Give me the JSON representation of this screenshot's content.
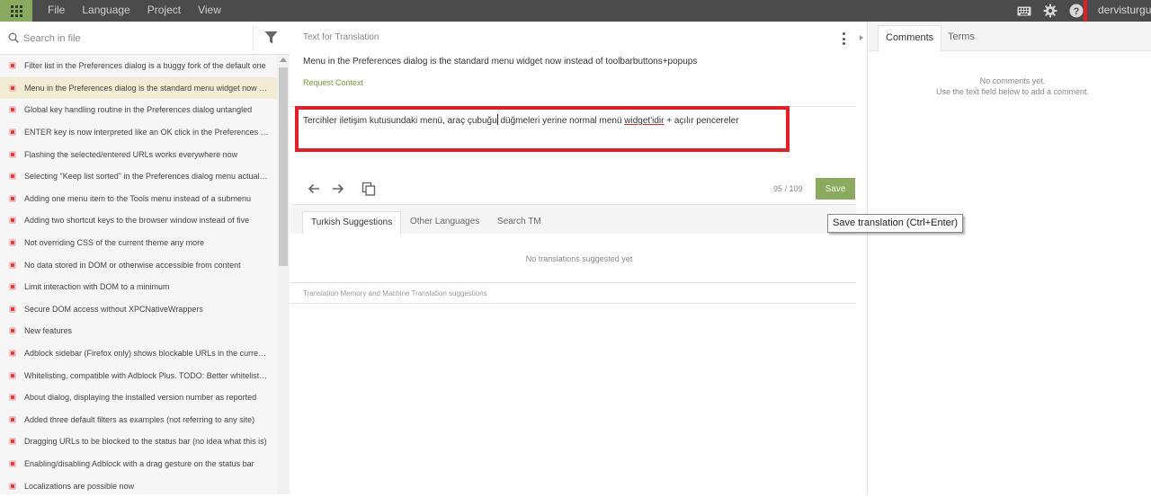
{
  "topbar": {
    "menu": [
      "File",
      "Language",
      "Project",
      "View"
    ],
    "icons": [
      "keyboard-icon",
      "gear-icon",
      "help-icon"
    ],
    "username": "dervisturgut",
    "colors": {
      "bar": "#4b4b4b",
      "accent": "#8aab5f",
      "highlight_box": "#e01f26"
    }
  },
  "sidebar": {
    "search_placeholder": "Search in file",
    "items": [
      "Filter list in the Preferences dialog is a buggy fork of the default one",
      "Menu in the Preferences dialog is the standard menu widget now instead",
      "Global key handling routine in the Preferences dialog untangled",
      "ENTER key is now interpreted like an OK click in the Preferences dialog",
      "Flashing the selected/entered URLs works everywhere now",
      "Selecting \"Keep list sorted\" in the Preferences dialog menu actually sorts",
      "Adding one menu item to the Tools menu instead of a submenu",
      "Adding two shortcut keys to the browser window instead of five",
      "Not overriding CSS of the current theme any more",
      "No data stored in DOM or otherwise accessible from content",
      "Limit interaction with DOM to a minimum",
      "Secure DOM access without XPCNativeWrappers",
      "New features",
      "Adblock sidebar (Firefox only) shows blockable URLs in the current page",
      "Whitelisting, compatible with Adblock Plus. TODO: Better whitelisting",
      "About dialog, displaying the installed version number as reported",
      "Added three default filters as examples (not referring to any site)",
      "Dragging URLs to be blocked to the status bar (no idea what this is)",
      "Enabling/disabling Adblock with a drag gesture on the status bar",
      "Localizations are possible now"
    ],
    "selected_index": 1
  },
  "editor": {
    "panel_title": "Text for Translation",
    "source_text": "Menu in the Preferences dialog is the standard menu widget now instead of toolbarbuttons+popups",
    "request_context": "Request Context",
    "translation_before_caret": "Tercihler iletişim kutusundaki menü, araç çubuğu",
    "translation_after_caret": " düğmeleri yerine normal menü ",
    "translation_misspelled": "widget'idir",
    "translation_tail": " + açılır pencereler",
    "counter": "95 / 109",
    "save_label": "Save",
    "tooltip": "Save translation (Ctrl+Enter)",
    "tabs": [
      "Turkish Suggestions",
      "Other Languages",
      "Search TM"
    ],
    "no_suggestions": "No translations suggested yet",
    "tm_note": "Translation Memory and Machine Translation suggestions"
  },
  "comments": {
    "tabs": [
      "Comments",
      "Terms"
    ],
    "empty_line1": "No comments yet.",
    "empty_line2": "Use the text field below to add a comment."
  }
}
